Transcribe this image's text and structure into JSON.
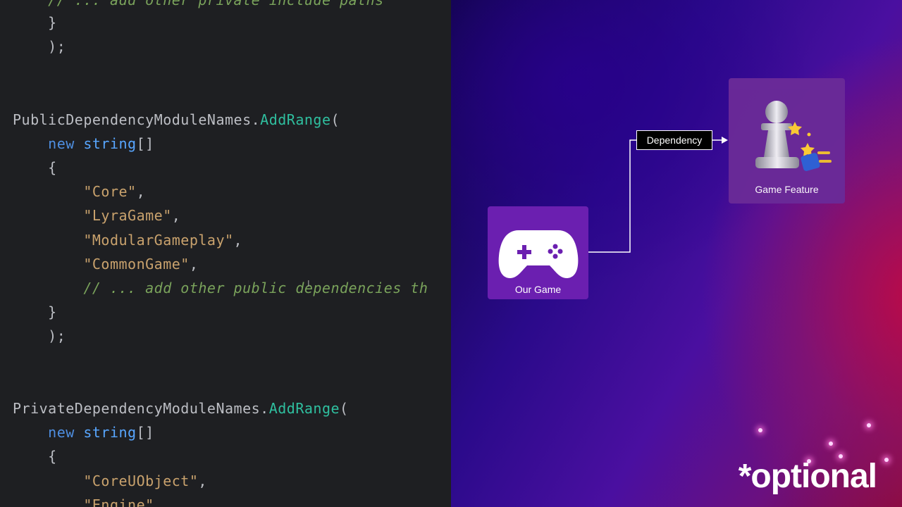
{
  "code": {
    "lines": [
      {
        "indent": "    ",
        "comment": "// ... add other private include paths"
      },
      {
        "indent": "    ",
        "punct": "}"
      },
      {
        "indent": "    ",
        "punct": ");"
      },
      {
        "object": "PublicDependencyModuleNames",
        "dot": ".",
        "method": "AddRange",
        "open": "("
      },
      {
        "indent": "    ",
        "keyword": "new",
        "type": "string",
        "brackets": "[]"
      },
      {
        "indent": "    ",
        "punct": "{"
      },
      {
        "indent": "        ",
        "string": "\"Core\"",
        "tail": ","
      },
      {
        "indent": "        ",
        "string": "\"LyraGame\"",
        "tail": ","
      },
      {
        "indent": "        ",
        "string": "\"ModularGameplay\"",
        "tail": ","
      },
      {
        "indent": "        ",
        "string": "\"CommonGame\"",
        "tail": ","
      },
      {
        "indent": "        ",
        "comment": "// ... add other public dependencies th"
      },
      {
        "indent": "    ",
        "punct": "}"
      },
      {
        "indent": "    ",
        "punct": ");"
      },
      {
        "object": "PrivateDependencyModuleNames",
        "dot": ".",
        "method": "AddRange",
        "open": "("
      },
      {
        "indent": "    ",
        "keyword": "new",
        "type": "string",
        "brackets": "[]"
      },
      {
        "indent": "    ",
        "punct": "{"
      },
      {
        "indent": "        ",
        "string": "\"CoreUObject\"",
        "tail": ","
      },
      {
        "indent": "        ",
        "string": "\"Engine\"",
        "tail": ","
      }
    ]
  },
  "diagram": {
    "our_game_label": "Our Game",
    "dependency_label": "Dependency",
    "game_feature_label": "Game Feature",
    "icons": {
      "our_game": "gamepad-icon",
      "game_feature": "chess-pawn-plugin-icon"
    },
    "colors": {
      "node_our_game": "#6b1fb0",
      "node_game_feature": "#6a2a98",
      "connector": "#ffffff"
    }
  },
  "note": "*optional"
}
